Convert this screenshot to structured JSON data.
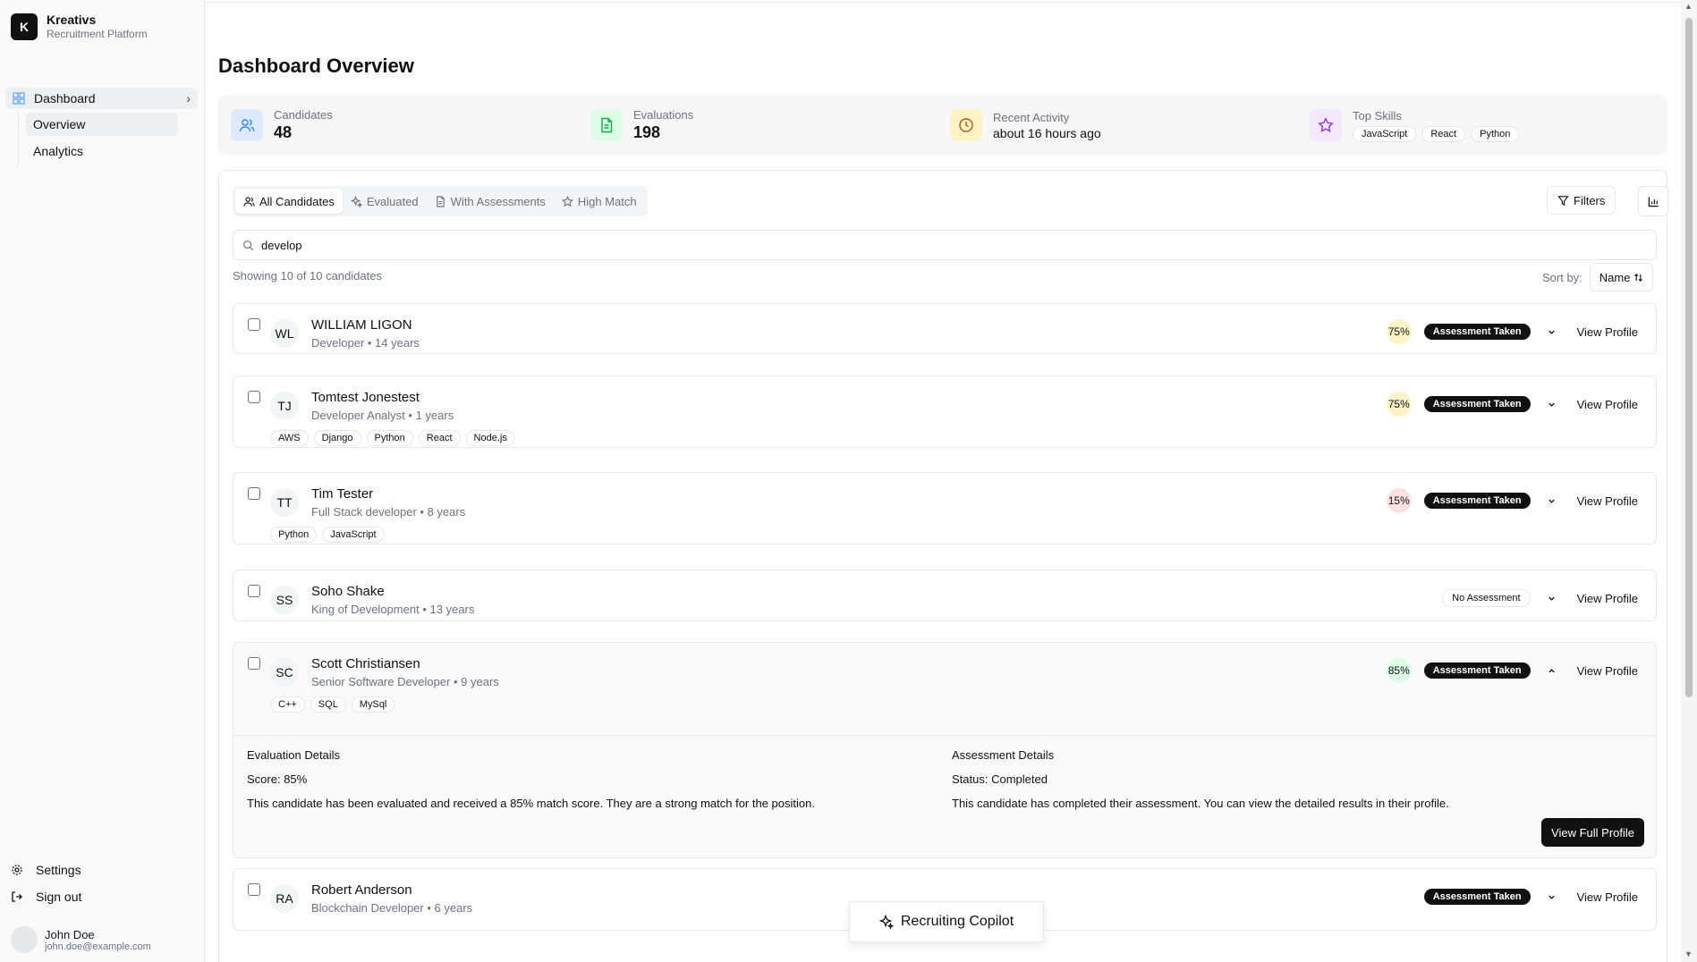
{
  "brand": {
    "logo_letter": "K",
    "name": "Kreativs",
    "subtitle": "Recruitment Platform"
  },
  "sidebar": {
    "main_item": "Dashboard",
    "sub_items": [
      {
        "label": "Overview",
        "active": true
      },
      {
        "label": "Analytics",
        "active": false
      }
    ],
    "settings": "Settings",
    "sign_out": "Sign out",
    "user": {
      "name": "John Doe",
      "email": "john.doe@example.com"
    }
  },
  "page": {
    "title": "Dashboard Overview"
  },
  "stats": {
    "candidates": {
      "label": "Candidates",
      "value": "48"
    },
    "evaluations": {
      "label": "Evaluations",
      "value": "198"
    },
    "recent": {
      "label": "Recent Activity",
      "value": "about 16 hours ago"
    },
    "skills": {
      "label": "Top Skills",
      "items": [
        "JavaScript",
        "React",
        "Python"
      ]
    }
  },
  "tabs": [
    "All Candidates",
    "Evaluated",
    "With Assessments",
    "High Match"
  ],
  "toolbar": {
    "filters": "Filters"
  },
  "search": {
    "value": "develop"
  },
  "list": {
    "showing": "Showing 10 of 10 candidates",
    "sort_label": "Sort by:",
    "sort_value": "Name"
  },
  "candidates": [
    {
      "initials": "WL",
      "name": "WILLIAM LIGON",
      "role": "Developer",
      "years": "• 14 years",
      "score": "75%",
      "status": "Assessment Taken",
      "tags": []
    },
    {
      "initials": "TJ",
      "name": "Tomtest Jonestest",
      "role": "Developer Analyst",
      "years": "• 1 years",
      "score": "75%",
      "status": "Assessment Taken",
      "tags": [
        "AWS",
        "Django",
        "Python",
        "React",
        "Node.js"
      ]
    },
    {
      "initials": "TT",
      "name": "Tim Tester",
      "role": "Full Stack developer",
      "years": "• 8 years",
      "score": "15%",
      "status": "Assessment Taken",
      "tags": [
        "Python",
        "JavaScript"
      ]
    },
    {
      "initials": "SS",
      "name": "Soho Shake",
      "role": "King of Development",
      "years": "• 13 years",
      "score": "",
      "status": "No Assessment",
      "tags": []
    },
    {
      "initials": "SC",
      "name": "Scott Christiansen",
      "role": "Senior Software Developer",
      "years": "• 9 years",
      "score": "85%",
      "status": "Assessment Taken",
      "tags": [
        "C++",
        "SQL",
        "MySql"
      ]
    },
    {
      "initials": "RA",
      "name": "Robert Anderson",
      "role": "Blockchain Developer",
      "years": "• 6 years",
      "score": "",
      "status": "Assessment Taken",
      "tags": []
    }
  ],
  "view_profile": "View Profile",
  "details": {
    "eval_title": "Evaluation Details",
    "score_label": "Score:",
    "score_value": "85%",
    "eval_text": "This candidate has been evaluated and received a 85% match score. They are a strong match for the position.",
    "assess_title": "Assessment Details",
    "status_label": "Status:",
    "status_value": "Completed",
    "assess_text": "This candidate has completed their assessment. You can view the detailed results in their profile.",
    "full_profile": "View Full Profile"
  },
  "copilot": "Recruiting Copilot",
  "colors": {
    "score_high": "#dcfce7",
    "score_mid": "#fef3c7",
    "score_low": "#fee2e2"
  }
}
